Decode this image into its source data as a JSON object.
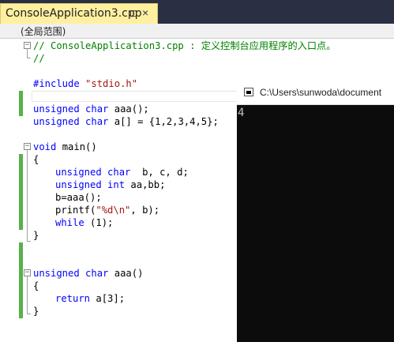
{
  "tab": {
    "title": "ConsoleApplication3.cpp",
    "pin_glyph": "⊡",
    "close_glyph": "×"
  },
  "navbar": {
    "scope": "(全局范围)"
  },
  "code": {
    "l1_comment": "// ConsoleApplication3.cpp : 定义控制台应用程序的入口点。",
    "l2_comment": "//",
    "l4_include": "#include ",
    "l4_header": "\"stdio.h\"",
    "l6_kw1": "unsigned",
    "l6_kw2": "char",
    "l6_rest": " aaa();",
    "l7_kw1": "unsigned",
    "l7_kw2": "char",
    "l7_rest": " a[] = {1,2,3,4,5};",
    "l9_kw": "void",
    "l9_rest": " main()",
    "l10": "{",
    "l11_kw1": "unsigned",
    "l11_kw2": "char",
    "l11_rest": "  b, c, d;",
    "l12_kw1": "unsigned",
    "l12_kw2": "int",
    "l12_rest": " aa,bb;",
    "l13": "b=aaa();",
    "l14_fn": "printf(",
    "l14_str": "\"%d\\n\"",
    "l14_rest": ", b);",
    "l15_kw": "while",
    "l15_rest": " (1);",
    "l16": "}",
    "l19_kw1": "unsigned",
    "l19_kw2": "char",
    "l19_rest": " aaa()",
    "l20": "{",
    "l21_kw": "return",
    "l21_rest": " a[3];",
    "l22": "}",
    "fold_glyph": "−"
  },
  "console": {
    "title": "C:\\Users\\sunwoda\\document",
    "output": "4"
  },
  "colors": {
    "keyword": "#0000ff",
    "string": "#a31515",
    "comment": "#008000",
    "preprocessor": "#808080",
    "change_marker": "#59b04a",
    "tab_active": "#fff0a0",
    "tabbar": "#2b2f43"
  }
}
